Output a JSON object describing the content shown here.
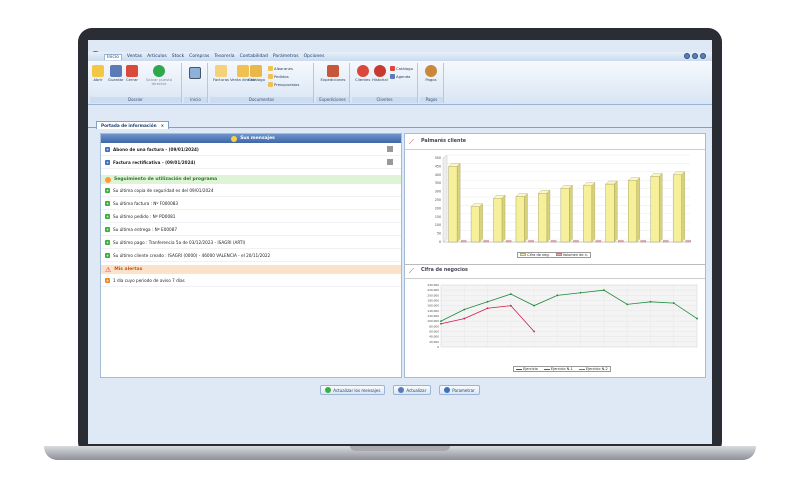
{
  "menu": [
    "Inicio",
    "Ventas",
    "Artículos",
    "Stock",
    "Compras",
    "Tesorería",
    "Contabilidad",
    "Parámetros",
    "Opciones"
  ],
  "ribbon": {
    "groups": [
      {
        "label": "Dossier",
        "buttons": [
          "Abrir",
          "Guardar",
          "Cerrar",
          "Salvar puesto director"
        ]
      },
      {
        "label": "Inicio",
        "buttons": [
          ""
        ]
      },
      {
        "label": "Documentos",
        "buttons": [
          "Facturas",
          "Venta directa",
          "Catálogo"
        ],
        "small": [
          "Albaranes",
          "Pedidos",
          "Presupuestos"
        ]
      },
      {
        "label": "Expediciones",
        "buttons": [
          "Expediciones"
        ]
      },
      {
        "label": "Clientes",
        "buttons": [
          "Clientes",
          "Historial"
        ],
        "small": [
          "Catálogo",
          "Agenda"
        ]
      },
      {
        "label": "Pagos",
        "buttons": [
          "Pagos"
        ]
      }
    ]
  },
  "tab": {
    "label": "Portada de información",
    "close": "×"
  },
  "messages": {
    "title": "Sus mensajes",
    "items": [
      "Abono de una factura - (09/01/2024)",
      "Factura rectificativa - (09/01/2024)"
    ]
  },
  "tracking": {
    "title": "Seguimiento de utilización del programa",
    "items": [
      "Su última copia de seguridad es del 09/01/2024",
      "Su última factura : Nº F000083",
      "Su último pedido : Nº PD0081",
      "Su última entrega : Nº E00087",
      "Su último pago : Tranferencia 5a de 03/12/2023 - ISAGRI (ARTI)",
      "Su último cliente creado : ISAGRI (0000) - 46000 VALENCIA - el 20/11/2022"
    ]
  },
  "alerts": {
    "title": "Mis alertas",
    "items": [
      "1 día cuyo periodo de aviso 7 días"
    ]
  },
  "buttons": {
    "refresh": "Actualizar los mensajes",
    "update": "Actualizar",
    "backup": "Parametrar"
  },
  "chart1": {
    "title": "Palmarés cliente",
    "legend": [
      "Cifra de neg.",
      "Volumen de n."
    ]
  },
  "chart2": {
    "title": "Cifra de negocios",
    "legend": [
      "Ejercicio",
      "Ejercicio N-1",
      "Ejercicio N-2"
    ]
  },
  "chart_data": [
    {
      "type": "bar",
      "title": "Palmarés cliente",
      "categories": [
        "",
        "",
        "",
        "",
        "",
        "",
        "",
        "",
        "",
        "",
        ""
      ],
      "series": [
        {
          "name": "Cifra de neg.",
          "values": [
            450,
            210,
            260,
            270,
            290,
            320,
            335,
            345,
            365,
            390,
            400
          ]
        },
        {
          "name": "Volumen de n.",
          "values": [
            0,
            0,
            0,
            0,
            0,
            0,
            0,
            0,
            0,
            0,
            0
          ]
        }
      ],
      "ylim": [
        0,
        500
      ],
      "yticks": [
        0,
        50,
        100,
        150,
        200,
        250,
        300,
        350,
        400,
        450,
        500
      ],
      "colors": [
        "#f7f09a",
        "#f4a8a8"
      ]
    },
    {
      "type": "line",
      "title": "Cifra de negocios",
      "x": [
        1,
        2,
        3,
        4,
        5,
        6,
        7,
        8,
        9,
        10,
        11,
        12
      ],
      "series": [
        {
          "name": "Ejercicio N-1",
          "values": [
            100000,
            145000,
            175000,
            205000,
            160000,
            200000,
            210000,
            220000,
            165000,
            175000,
            170000,
            110000
          ],
          "color": "#1a8a3a"
        },
        {
          "name": "Ejercicio",
          "values": [
            90000,
            110000,
            150000,
            160000,
            60000,
            null,
            null,
            null,
            null,
            null,
            null,
            null
          ],
          "color": "#d11a4a"
        }
      ],
      "ylim": [
        0,
        240000
      ],
      "yticks": [
        0,
        20000,
        40000,
        60000,
        80000,
        100000,
        120000,
        140000,
        160000,
        180000,
        200000,
        220000,
        240000
      ]
    }
  ],
  "colors": {
    "accent": "#1e3d6b",
    "ribbon": "#d8e5f4",
    "green_head": "#dff3d7",
    "orange_head": "#fbe2c9"
  }
}
